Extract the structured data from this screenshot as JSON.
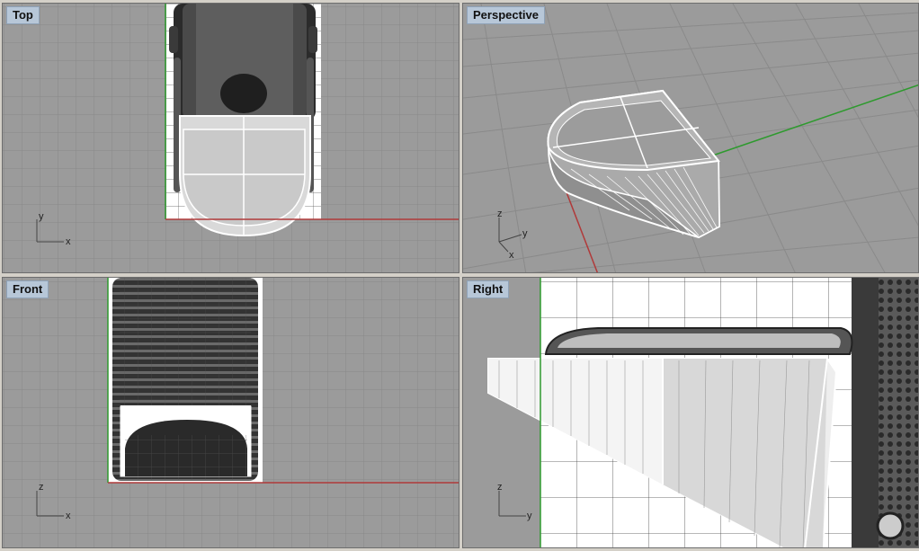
{
  "viewports": {
    "top": {
      "title": "Top",
      "axis": {
        "a": "y",
        "b": "x"
      }
    },
    "perspective": {
      "title": "Perspective",
      "axis": {
        "z": "z",
        "y": "y",
        "x": "x"
      }
    },
    "front": {
      "title": "Front",
      "axis": {
        "a": "z",
        "b": "x"
      }
    },
    "right": {
      "title": "Right",
      "axis": {
        "a": "z",
        "b": "y"
      }
    }
  },
  "colors": {
    "viewport_bg": "#9b9b9b",
    "grid_minor": "#8c8c8c",
    "grid_major": "#7a7a7a",
    "x_axis": "#b03a3a",
    "y_axis": "#2e9a2e",
    "title_bg": "#b7c7d8"
  }
}
